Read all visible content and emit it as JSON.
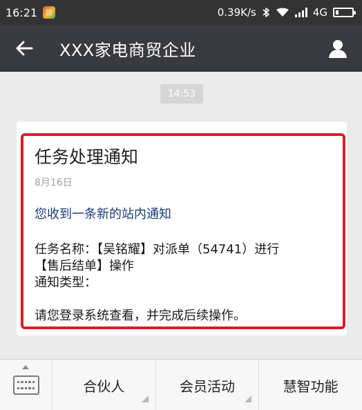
{
  "status_bar": {
    "time": "16:21",
    "net_speed": "0.39K/s",
    "network_type": "4G",
    "icons": [
      "app-icon",
      "bluetooth-icon",
      "wifi-icon",
      "signal-icon",
      "battery-icon"
    ]
  },
  "header": {
    "title": "XXX家电商贸企业",
    "back_icon": "back-arrow-icon",
    "profile_icon": "profile-icon"
  },
  "chat": {
    "timestamp": "14:53",
    "message": {
      "title": "任务处理通知",
      "date": "8月16日",
      "intro": "您收到一条新的站内通知",
      "task_line_1": "任务名称：【吴铭耀】对派单（54741）进行",
      "task_line_2": "【售后结单】操作",
      "type_line": "通知类型：",
      "closing": "请您登录系统查看，并完成后续操作。"
    }
  },
  "bottom_menu": {
    "keyboard_icon": "keyboard-icon",
    "items": [
      {
        "label": "合伙人"
      },
      {
        "label": "会员活动"
      },
      {
        "label": "慧智功能"
      }
    ]
  },
  "colors": {
    "status_bg": "#333333",
    "header_bg": "#393a3f",
    "chat_bg": "#ebebeb",
    "highlight_border": "#d61f27",
    "intro_text": "#1a3a7a"
  }
}
